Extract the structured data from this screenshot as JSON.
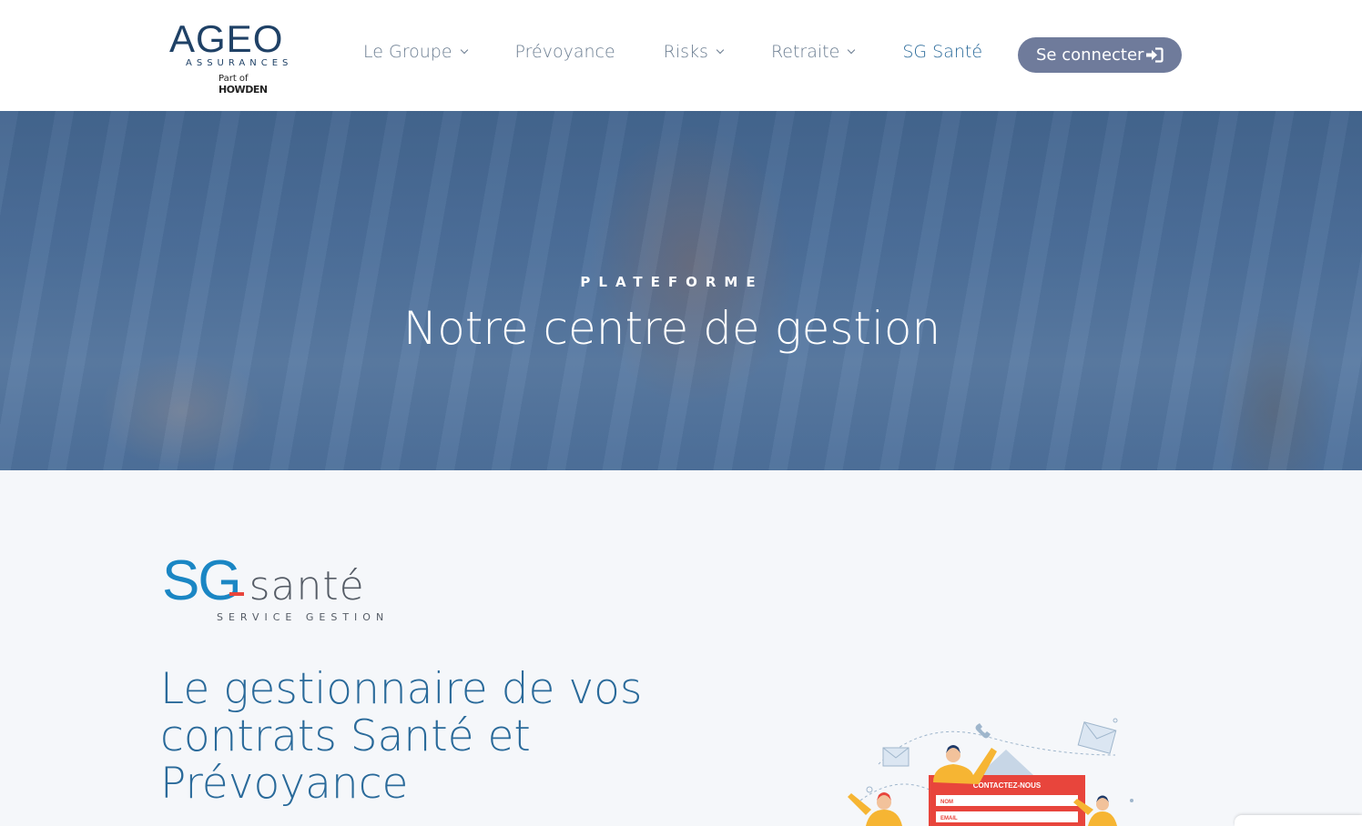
{
  "header": {
    "logo": {
      "brand": "AGEO",
      "subtitle": "ASSURANCES",
      "partof_prefix": "Part of",
      "partof_brand": "HOWDEN"
    },
    "nav": [
      {
        "label": "Le Groupe",
        "has_dropdown": true
      },
      {
        "label": "Prévoyance",
        "has_dropdown": false
      },
      {
        "label": "Risks",
        "has_dropdown": true
      },
      {
        "label": "Retraite",
        "has_dropdown": true
      },
      {
        "label": "SG Santé",
        "has_dropdown": false,
        "active": true
      }
    ],
    "login_label": "Se connecter",
    "login_icon": "sign-in-icon"
  },
  "hero": {
    "eyebrow": "PLATEFORME",
    "title": "Notre centre de gestion"
  },
  "content": {
    "sg_logo": {
      "sg": "SG",
      "sante": "santé",
      "tagline": "SERVICE GESTION"
    },
    "heading": "Le gestionnaire de vos contrats Santé et Prévoyance"
  },
  "illustration": {
    "form_title": "CONTACTEZ-NOUS",
    "field_1": "NOM",
    "field_2": "EMAIL"
  },
  "colors": {
    "accent": "#2a6a9a",
    "login_button": "#6f7b9b",
    "sg_blue": "#1a86c4",
    "sg_red": "#e8453c",
    "form_red": "#e8453c"
  }
}
